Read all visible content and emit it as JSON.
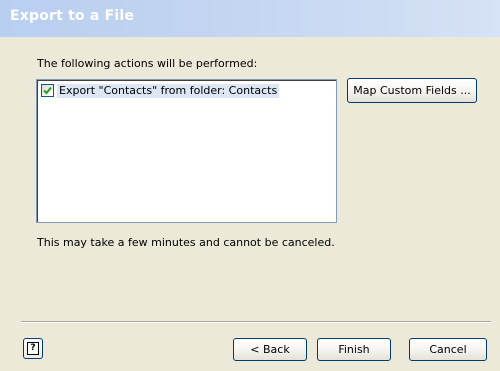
{
  "window": {
    "title": "Export to a File"
  },
  "content": {
    "heading": "The following actions will be performed:",
    "actions": [
      {
        "label": "Export \"Contacts\" from folder: Contacts",
        "checked": true
      }
    ],
    "note": "This may take a few minutes and cannot be canceled."
  },
  "buttons": {
    "map_custom_fields": "Map Custom Fields ...",
    "help": "?",
    "back": "< Back",
    "finish": "Finish",
    "cancel": "Cancel"
  },
  "icons": {
    "help": "help-icon",
    "checkbox": "checkmark-icon"
  },
  "colors": {
    "title_bar": "#b9cff0",
    "dialog_bg": "#ece9d8",
    "selection": "#dce6f4",
    "check": "#21a121"
  }
}
